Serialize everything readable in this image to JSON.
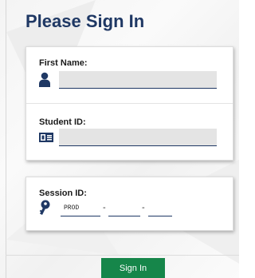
{
  "header": {
    "title": "Please Sign In"
  },
  "user_card": {
    "first_name": {
      "label": "First Name:",
      "value": "",
      "icon": "person-icon"
    },
    "student_id": {
      "label": "Student ID:",
      "value": "",
      "icon": "id-card-icon"
    }
  },
  "session_card": {
    "label": "Session ID:",
    "icon": "key-icon",
    "segments": [
      "PROD",
      "",
      ""
    ],
    "separator": "-"
  },
  "footer": {
    "sign_in_label": "Sign In"
  },
  "colors": {
    "title": "#1f3864",
    "icons": "#1f3864",
    "button": "#16864a",
    "input_fill": "#e4e4e4"
  }
}
